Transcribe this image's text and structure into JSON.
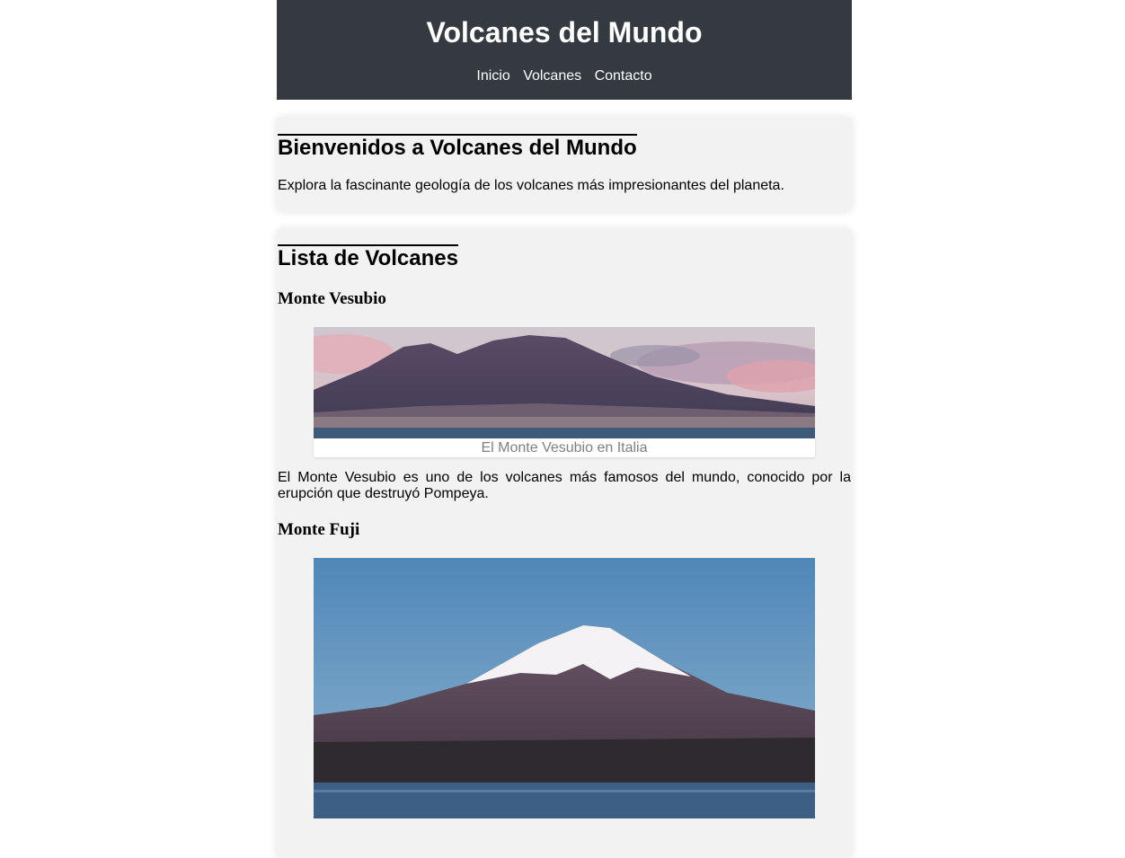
{
  "header": {
    "title": "Volcanes del Mundo",
    "nav": [
      "Inicio",
      "Volcanes",
      "Contacto"
    ]
  },
  "welcome": {
    "title": "Bienvenidos a Volcanes del Mundo",
    "text": "Explora la fascinante geología de los volcanes más impresionantes del planeta."
  },
  "list": {
    "title": "Lista de Volcanes",
    "volcanoes": [
      {
        "name": "Monte Vesubio",
        "caption": "El Monte Vesubio en Italia",
        "description": "El Monte Vesubio es uno de los volcanes más famosos del mundo, conocido por la erupción que destruyó Pompeya."
      },
      {
        "name": "Monte Fuji"
      }
    ]
  },
  "colors": {
    "header_bg": "#343a40",
    "section_bg": "#f2f2f2",
    "caption_text": "#808080"
  }
}
